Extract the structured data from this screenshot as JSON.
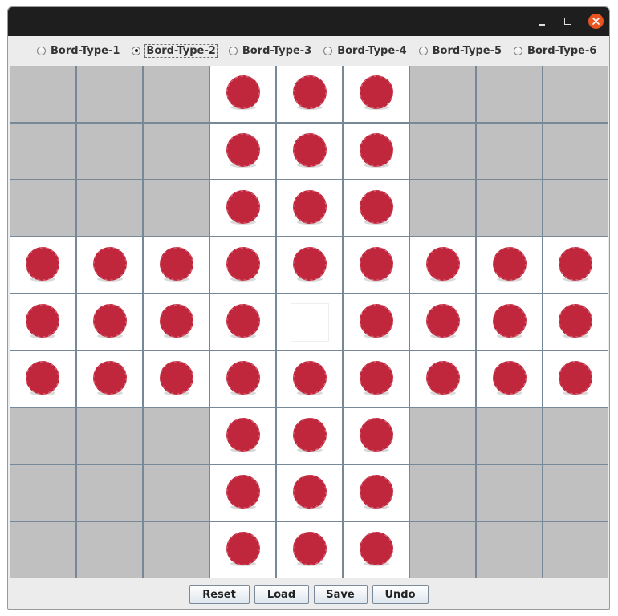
{
  "window": {
    "controls": {
      "minimize_icon": "minimize-icon",
      "maximize_icon": "maximize-icon",
      "close_icon": "close-icon"
    }
  },
  "board_types": [
    {
      "label": "Bord-Type-1",
      "checked": false
    },
    {
      "label": "Bord-Type-2",
      "checked": true
    },
    {
      "label": "Bord-Type-3",
      "checked": false
    },
    {
      "label": "Bord-Type-4",
      "checked": false
    },
    {
      "label": "Bord-Type-5",
      "checked": false
    },
    {
      "label": "Bord-Type-6",
      "checked": false
    }
  ],
  "board": {
    "rows": 9,
    "cols": 9,
    "grid": [
      "XXXPPPXXX",
      "XXXPPPXXX",
      "XXXPPPXXX",
      "PPPPPPPPP",
      "PPPPEPPPP",
      "PPPPPPPPP",
      "XXXPPPXXX",
      "XXXPPPXXX",
      "XXXPPPXXX"
    ],
    "legend": {
      "X": "blocked",
      "P": "peg",
      "E": "empty"
    },
    "colors": {
      "peg": "#c0273d",
      "blocked": "#c0c0c0",
      "open": "#ffffff",
      "grid_line": "#778899"
    }
  },
  "buttons": {
    "reset": "Reset",
    "load": "Load",
    "save": "Save",
    "undo": "Undo"
  }
}
